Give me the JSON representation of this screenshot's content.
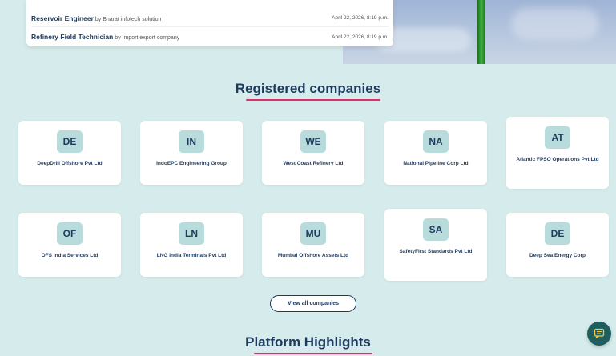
{
  "jobs": [
    {
      "title": "Reservoir Engineer",
      "by": "by Bharat infotech solution",
      "date": "April 22, 2026, 8:19 p.m."
    },
    {
      "title": "Refinery Field Technician",
      "by": "by Import export company",
      "date": "April 22, 2026, 8:19 p.m."
    }
  ],
  "companies_section": {
    "title": "Registered companies",
    "companies": [
      {
        "initials": "DE",
        "name": "DeepDrill Offshore Pvt Ltd"
      },
      {
        "initials": "IN",
        "name": "IndoEPC Engineering Group"
      },
      {
        "initials": "WE",
        "name": "West Coast Refinery Ltd"
      },
      {
        "initials": "NA",
        "name": "National Pipeline Corp Ltd"
      },
      {
        "initials": "AT",
        "name": "Atlantic FPSO Operations Pvt Ltd"
      },
      {
        "initials": "OF",
        "name": "OFS India Services Ltd"
      },
      {
        "initials": "LN",
        "name": "LNG India Terminals Pvt Ltd"
      },
      {
        "initials": "MU",
        "name": "Mumbai Offshore Assets Ltd"
      },
      {
        "initials": "SA",
        "name": "SafetyFirst Standards Pvt Ltd"
      },
      {
        "initials": "DE",
        "name": "Deep Sea Energy Corp"
      }
    ],
    "view_all_label": "View all companies"
  },
  "highlights_section": {
    "title": "Platform Highlights"
  },
  "chat_button_icon": "chat-icon",
  "colors": {
    "background": "#d6ebeb",
    "accent_underline": "#d6336c",
    "badge": "#b8dcdc",
    "heading": "#1e3a5f",
    "chat_button": "#1f5e5e"
  }
}
